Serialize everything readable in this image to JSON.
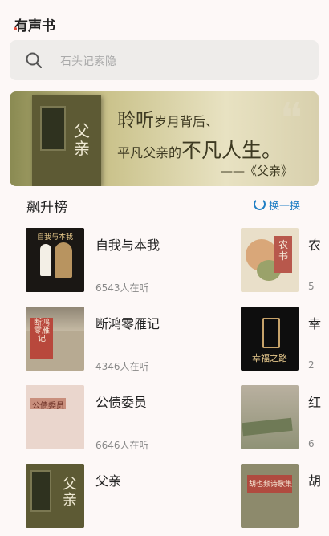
{
  "header": {
    "title": "有声书"
  },
  "search": {
    "placeholder": "石头记索隐"
  },
  "banner": {
    "line1_big": "聆听",
    "line1_small": "岁月背后、",
    "line2_small": "平凡父亲的",
    "line2_big": "不凡人生。",
    "line3": "——《父亲》",
    "cover_title": "父亲",
    "quote_mark": "❝"
  },
  "section": {
    "title": "飙升榜",
    "refresh_label": "换一换"
  },
  "left_list": [
    {
      "name": "自我与本我",
      "listeners": "6543人在听",
      "cover_text": "自我与本我"
    },
    {
      "name": "断鸿零雁记",
      "listeners": "4346人在听",
      "cover_text": "断鸿零雁记"
    },
    {
      "name": "公债委员",
      "listeners": "6646人在听",
      "cover_text": "公债委员"
    },
    {
      "name": "父亲",
      "listeners": "",
      "cover_text": "父亲"
    }
  ],
  "right_list": [
    {
      "name": "农",
      "listeners": "5",
      "cover_text": "农书"
    },
    {
      "name": "幸",
      "listeners": "2",
      "cover_text": "幸福之路"
    },
    {
      "name": "红",
      "listeners": "6",
      "cover_text": ""
    },
    {
      "name": "胡",
      "listeners": "",
      "cover_text": "胡也频诗歌集"
    }
  ]
}
